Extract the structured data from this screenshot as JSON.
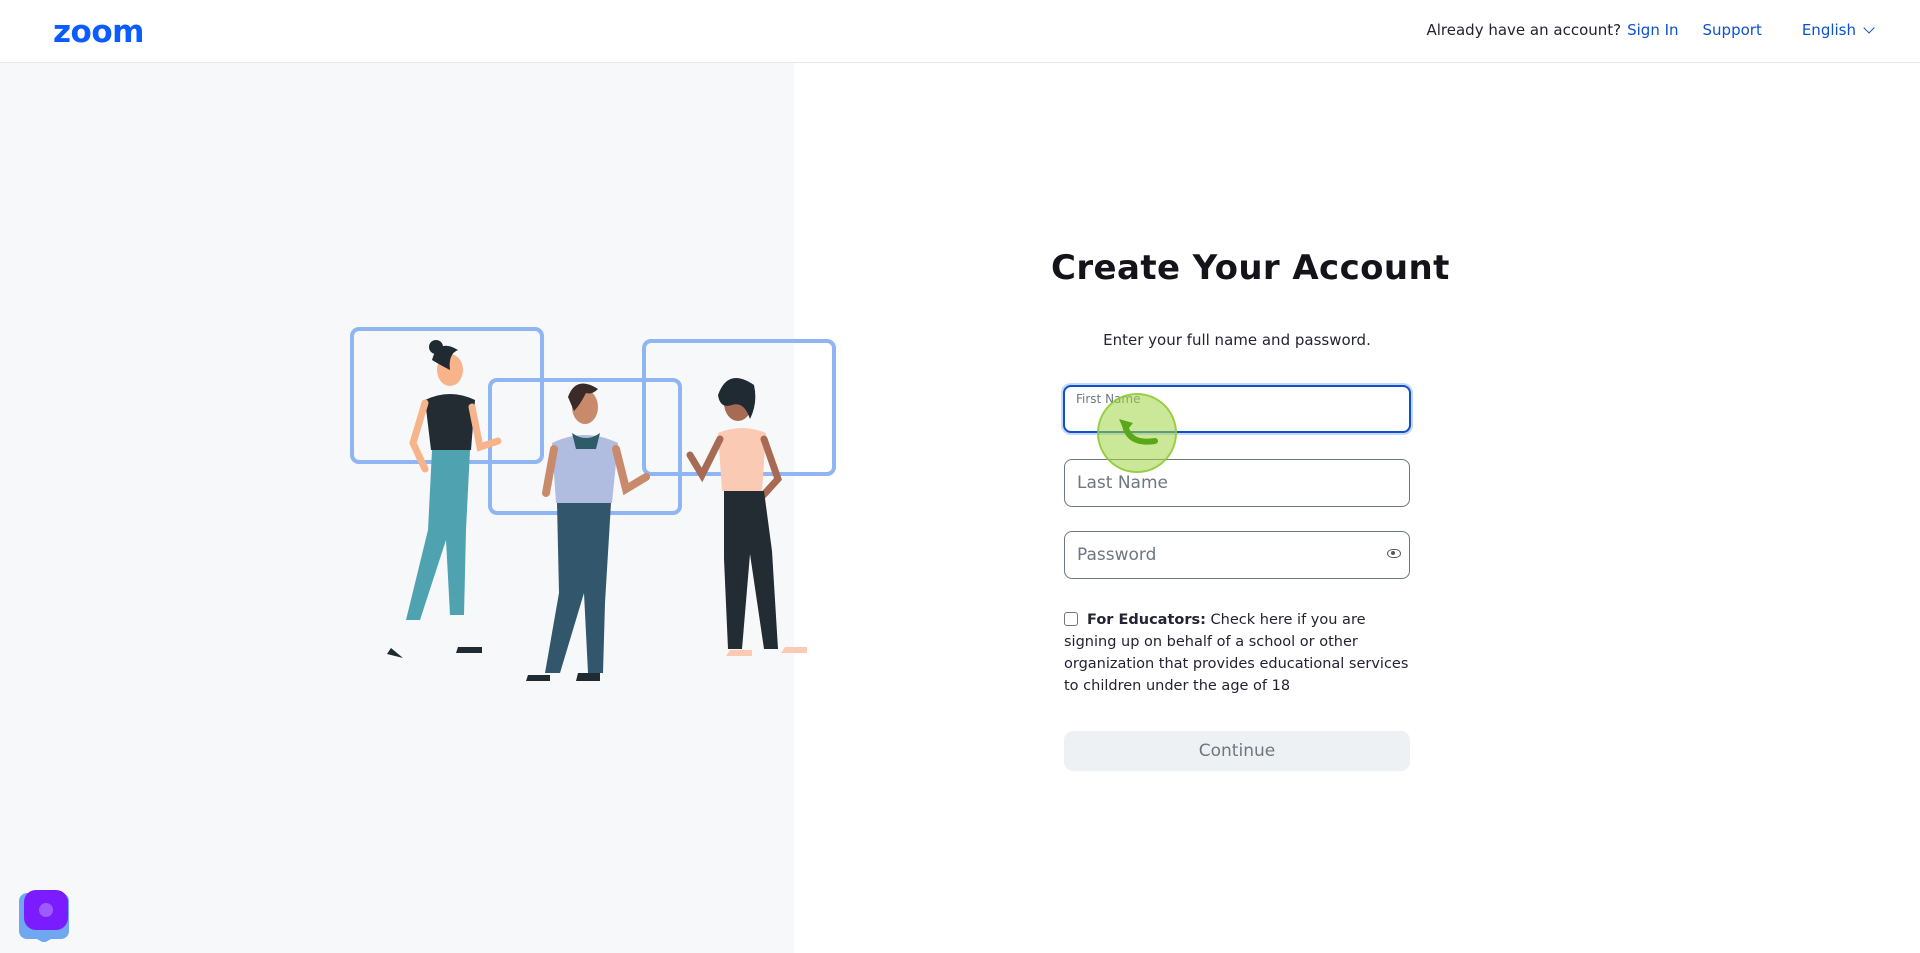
{
  "header": {
    "logo": "zoom",
    "account_question": "Already have an account?",
    "sign_in": "Sign In",
    "support": "Support",
    "language": "English"
  },
  "form": {
    "title": "Create Your Account",
    "subtitle": "Enter your full name and password.",
    "first_name": {
      "label": "First Name",
      "value": ""
    },
    "last_name": {
      "placeholder": "Last Name"
    },
    "password": {
      "placeholder": "Password"
    },
    "educators": {
      "bold": "For Educators:",
      "text": " Check here if you are signing up on behalf of a school or other organization that provides educational services to children under the age of 18",
      "checked": false
    },
    "continue": "Continue"
  },
  "colors": {
    "brand": "#0b5cff",
    "link": "#0e51cf",
    "left_panel_bg": "#f7f8fa",
    "frame_blue": "#8fb6f2",
    "widget_purple": "#7a1cff"
  },
  "icons": [
    "eye-icon",
    "chevron-down-icon",
    "chat-widget-icon"
  ]
}
